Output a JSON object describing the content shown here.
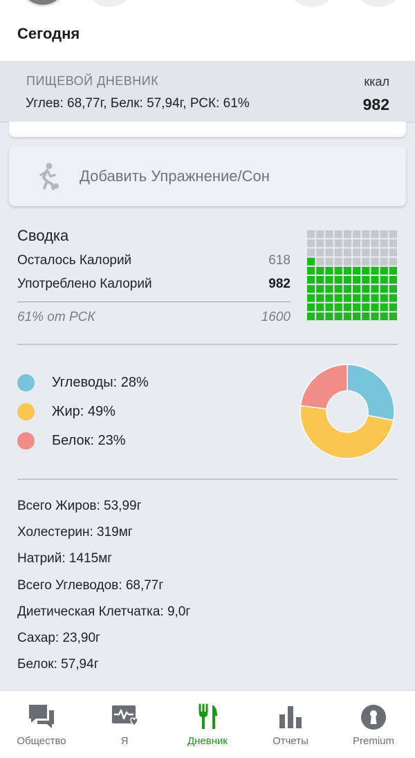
{
  "header": {
    "title": "Сегодня"
  },
  "diary": {
    "title": "ПИЩЕВОЙ ДНЕВНИК",
    "macros": "Углев: 68,77г, Белк: 57,94г, РСК: 61%",
    "unit": "ккал",
    "kcal": "982"
  },
  "add_exercise": {
    "label": "Добавить Упражнение/Сон",
    "icon": "running-person-icon"
  },
  "summary": {
    "title": "Сводка",
    "remaining_label": "Осталось Калорий",
    "remaining_value": "618",
    "consumed_label": "Употреблено Калорий",
    "consumed_value": "982",
    "rdi_label": "61% от РСК",
    "rdi_value": "1600",
    "waffle_fraction": 0.61,
    "waffle_colors": {
      "filled": "#1cb81c",
      "empty": "#c6c8cf"
    }
  },
  "macros": {
    "items": [
      {
        "label": "Углеводы: 28%",
        "value": 28,
        "color": "#77c4dc"
      },
      {
        "label": "Жир: 49%",
        "value": 49,
        "color": "#f9c74f"
      },
      {
        "label": "Белок: 23%",
        "value": 23,
        "color": "#f28c86"
      }
    ]
  },
  "nutrients": [
    "Всего Жиров: 53,99г",
    "Холестерин: 319мг",
    "Натрий: 1415мг",
    "Всего Углеводов: 68,77г",
    "Диетическая Клетчатка: 9,0г",
    "Сахар: 23,90г",
    "Белок: 57,94г"
  ],
  "nav": {
    "items": [
      {
        "label": "Общество",
        "icon": "chat-bubbles-icon"
      },
      {
        "label": "Я",
        "icon": "heart-pulse-icon"
      },
      {
        "label": "Дневник",
        "icon": "fork-knife-icon",
        "active": true
      },
      {
        "label": "Отчеты",
        "icon": "bar-chart-icon"
      },
      {
        "label": "Premium",
        "icon": "keyhole-icon"
      }
    ],
    "active_color": "#1a9a12",
    "inactive_color": "#6a6d73"
  }
}
